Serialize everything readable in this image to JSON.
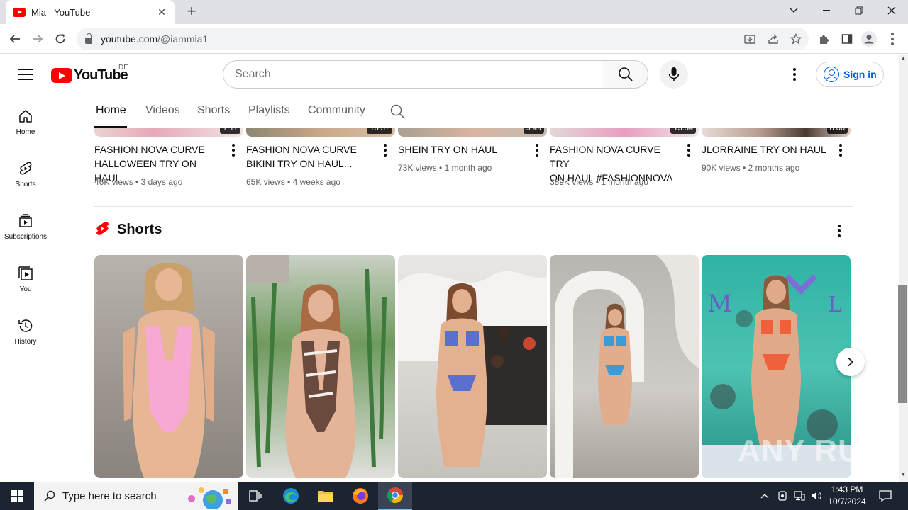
{
  "browser": {
    "tab_title": "Mia - YouTube",
    "url_host": "youtube.com",
    "url_path": "/@iammia1"
  },
  "youtube": {
    "country_code": "DE",
    "search_placeholder": "Search",
    "sign_in_label": "Sign in",
    "guide": [
      {
        "label": "Home",
        "icon": "home-icon"
      },
      {
        "label": "Shorts",
        "icon": "shorts-icon"
      },
      {
        "label": "Subscriptions",
        "icon": "subscriptions-icon"
      },
      {
        "label": "You",
        "icon": "you-icon"
      },
      {
        "label": "History",
        "icon": "history-icon"
      }
    ],
    "channel_tabs": [
      "Home",
      "Videos",
      "Shorts",
      "Playlists",
      "Community"
    ],
    "active_tab": "Home",
    "videos": [
      {
        "title_line1": "FASHION NOVA CURVE",
        "title_line2": "HALLOWEEN TRY ON HAUL",
        "views": "46K views",
        "age": "3 days ago",
        "duration": "7:11"
      },
      {
        "title_line1": "FASHION NOVA CURVE",
        "title_line2": "BIKINI TRY ON HAUL...",
        "views": "65K views",
        "age": "4 weeks ago",
        "duration": "10:37"
      },
      {
        "title_line1": "SHEIN TRY ON HAUL",
        "title_line2": "",
        "views": "73K views",
        "age": "1 month ago",
        "duration": "9:49"
      },
      {
        "title_line1": "FASHION NOVA CURVE TRY",
        "title_line2": "ON HAUL #FashionNova",
        "views": "389K views",
        "age": "1 month ago",
        "duration": "13:34"
      },
      {
        "title_line1": "JLORRAINE TRY ON HAUL",
        "title_line2": "",
        "views": "90K views",
        "age": "2 months ago",
        "duration": "8:06"
      }
    ],
    "shorts_heading": "Shorts"
  },
  "watermark": "ANY RUN",
  "taskbar": {
    "search_placeholder": "Type here to search",
    "time": "1:43 PM",
    "date": "10/7/2024"
  },
  "colors": {
    "youtube_red": "#ff0000",
    "link_blue": "#065fd4",
    "taskbar_bg": "#1c2431"
  }
}
